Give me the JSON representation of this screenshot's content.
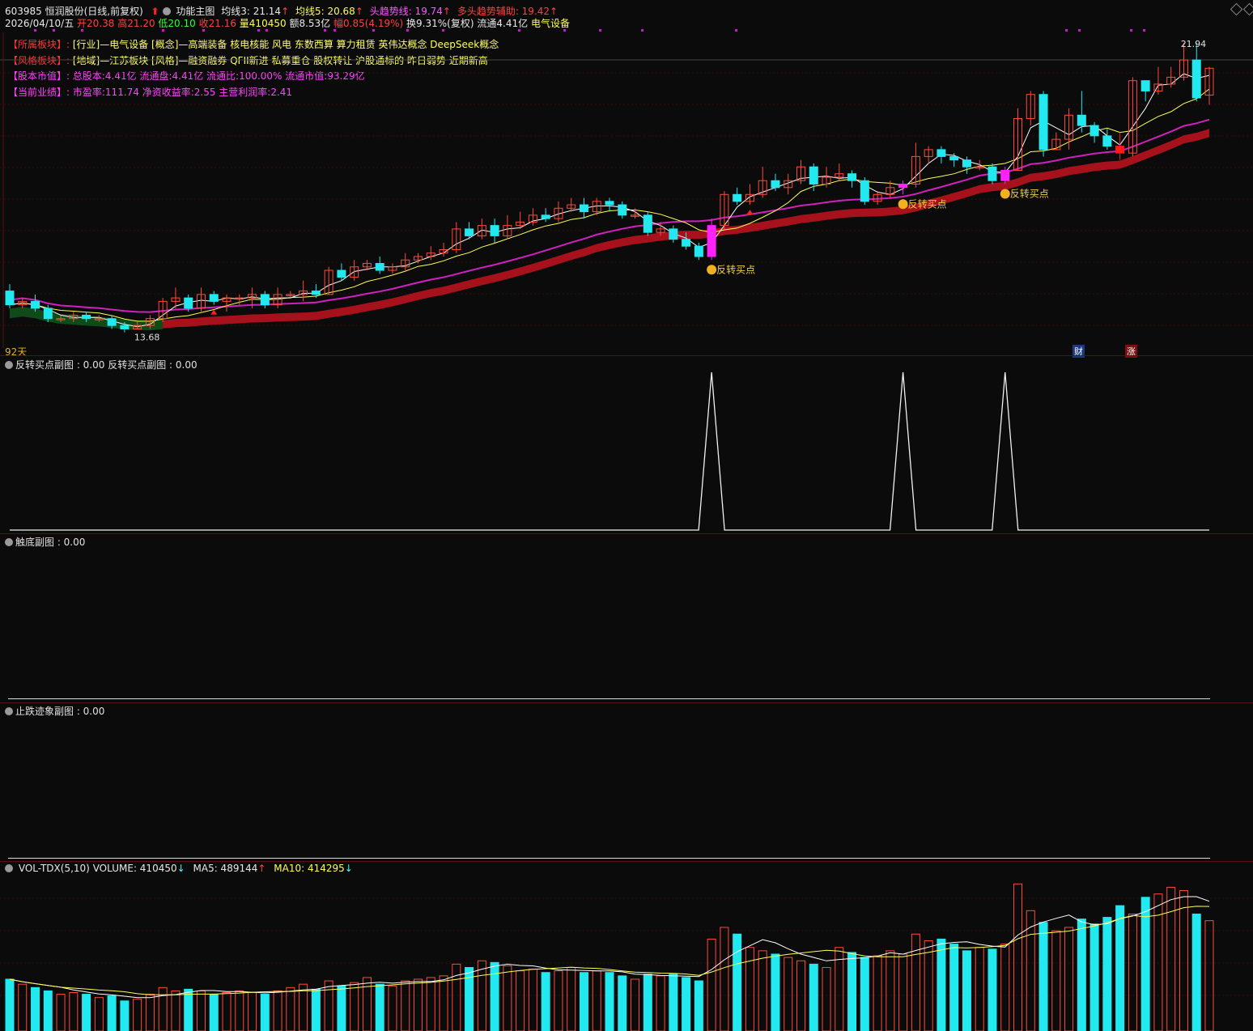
{
  "header": {
    "stock": "603985 恒润股份(日线,前复权)",
    "func_label": "功能主图",
    "ma3": "均线3: 21.14",
    "ma5": "均线5: 20.68",
    "trend_line": "头趋势线: 19.74",
    "trend_aux": "多头趋势辅助: 19.42",
    "date": "2026/04/10/五",
    "open": "开20.38",
    "high": "高21.20",
    "low": "低20.10",
    "close": "收21.16",
    "vol": "量410450",
    "amount": "额8.53亿",
    "change": "幅0.85(4.19%)",
    "turnover": "换9.31%(复权)",
    "float": "流通4.41亿",
    "sector": "电气设备"
  },
  "info": [
    {
      "tag": "【所属板块】:",
      "value": "[行业]—电气设备 [概念]—高端装备 核电核能 风电 东数西算 算力租赁 英伟达概念 DeepSeek概念",
      "color": "#ffff66"
    },
    {
      "tag": "【风格板块】:",
      "value": "[地域]—江苏板块 [风格]—融资融券 QFII新进 私募重仓 股权转让 沪股通标的 昨日弱势 近期新高",
      "color": "#ffff66"
    },
    {
      "tag": "【股本市值】:",
      "value": "总股本:4.41亿 流通盘:4.41亿 流通比:100.00% 流通市值:93.29亿",
      "color": "#ff44ff"
    },
    {
      "tag": "【当前业绩】:",
      "value": "市盈率:111.74 净资收益率:2.55 主营利润率:2.41",
      "color": "#ff44ff"
    }
  ],
  "main_chart": {
    "high_label": "21.94",
    "low_label": "13.68",
    "days_label": "92天",
    "signal_label": "反转买点",
    "badge_cai": "财",
    "badge_zhang": "涨"
  },
  "sub1": {
    "label": "反转买点副图 : 0.00  反转买点副图 : 0.00"
  },
  "sub2": {
    "label": "触底副图 : 0.00"
  },
  "sub3": {
    "label": "止跌迹象副图 : 0.00"
  },
  "vol_panel": {
    "name": "VOL-TDX(5,10)",
    "volume": "VOLUME: 410450",
    "ma5": "MA5: 489144",
    "ma10": "MA10: 414295"
  },
  "chart_data": {
    "type": "candlestick",
    "ohlc": [
      [
        14.7,
        14.3,
        14.9,
        14.2
      ],
      [
        14.3,
        14.4,
        14.5,
        14.2
      ],
      [
        14.4,
        14.2,
        14.6,
        14.1
      ],
      [
        14.2,
        13.9,
        14.3,
        13.8
      ],
      [
        13.9,
        13.9,
        14.0,
        13.8
      ],
      [
        13.9,
        14.0,
        14.1,
        13.8
      ],
      [
        14.0,
        13.9,
        14.1,
        13.8
      ],
      [
        13.9,
        13.9,
        14.0,
        13.8
      ],
      [
        13.9,
        13.7,
        14.0,
        13.6
      ],
      [
        13.7,
        13.6,
        13.8,
        13.5
      ],
      [
        13.6,
        13.7,
        13.8,
        13.6
      ],
      [
        13.7,
        13.9,
        14.0,
        13.6
      ],
      [
        13.9,
        14.4,
        14.5,
        13.8
      ],
      [
        14.4,
        14.5,
        14.8,
        14.2
      ],
      [
        14.5,
        14.2,
        14.6,
        14.1
      ],
      [
        14.2,
        14.6,
        14.8,
        14.1
      ],
      [
        14.6,
        14.4,
        14.7,
        14.3
      ],
      [
        14.4,
        14.5,
        14.6,
        14.1
      ],
      [
        14.5,
        14.5,
        14.6,
        14.3
      ],
      [
        14.5,
        14.6,
        14.8,
        14.2
      ],
      [
        14.6,
        14.3,
        14.7,
        14.2
      ],
      [
        14.3,
        14.6,
        14.8,
        14.2
      ],
      [
        14.6,
        14.6,
        14.7,
        14.5
      ],
      [
        14.6,
        14.7,
        15.0,
        14.4
      ],
      [
        14.7,
        14.6,
        14.9,
        14.5
      ],
      [
        14.6,
        15.3,
        15.4,
        14.6
      ],
      [
        15.3,
        15.1,
        15.5,
        15.0
      ],
      [
        15.1,
        15.4,
        15.6,
        15.0
      ],
      [
        15.4,
        15.5,
        15.6,
        15.3
      ],
      [
        15.5,
        15.3,
        15.7,
        15.2
      ],
      [
        15.3,
        15.4,
        15.5,
        15.2
      ],
      [
        15.4,
        15.6,
        15.8,
        15.3
      ],
      [
        15.6,
        15.7,
        15.8,
        15.5
      ],
      [
        15.7,
        15.8,
        16.0,
        15.6
      ],
      [
        15.8,
        15.9,
        16.1,
        15.7
      ],
      [
        15.9,
        16.5,
        16.7,
        15.8
      ],
      [
        16.5,
        16.3,
        16.7,
        16.2
      ],
      [
        16.3,
        16.6,
        16.8,
        16.2
      ],
      [
        16.6,
        16.3,
        16.8,
        16.1
      ],
      [
        16.3,
        16.6,
        16.9,
        16.2
      ],
      [
        16.6,
        16.7,
        17.0,
        16.5
      ],
      [
        16.7,
        16.9,
        17.1,
        16.6
      ],
      [
        16.9,
        16.8,
        17.1,
        16.7
      ],
      [
        16.8,
        17.1,
        17.3,
        16.7
      ],
      [
        17.1,
        17.2,
        17.4,
        17.0
      ],
      [
        17.2,
        17.0,
        17.4,
        16.8
      ],
      [
        17.0,
        17.3,
        17.4,
        16.9
      ],
      [
        17.3,
        17.2,
        17.4,
        17.0
      ],
      [
        17.2,
        16.9,
        17.3,
        16.8
      ],
      [
        16.9,
        16.9,
        17.1,
        16.8
      ],
      [
        16.9,
        16.4,
        17.0,
        16.3
      ],
      [
        16.4,
        16.5,
        16.7,
        16.3
      ],
      [
        16.5,
        16.2,
        16.6,
        16.1
      ],
      [
        16.2,
        16.0,
        16.4,
        15.9
      ],
      [
        16.0,
        15.7,
        16.1,
        15.6
      ],
      [
        15.7,
        16.6,
        16.8,
        15.6
      ],
      [
        16.6,
        17.5,
        17.6,
        16.5
      ],
      [
        17.5,
        17.3,
        17.7,
        17.2
      ],
      [
        17.3,
        17.5,
        17.8,
        17.2
      ],
      [
        17.5,
        17.9,
        18.3,
        17.4
      ],
      [
        17.9,
        17.7,
        18.1,
        17.6
      ],
      [
        17.7,
        17.9,
        18.1,
        17.5
      ],
      [
        17.9,
        18.3,
        18.5,
        17.8
      ],
      [
        18.3,
        17.8,
        18.4,
        17.6
      ],
      [
        17.8,
        18.0,
        18.3,
        17.7
      ],
      [
        18.0,
        18.1,
        18.4,
        17.9
      ],
      [
        18.1,
        17.9,
        18.2,
        17.7
      ],
      [
        17.9,
        17.3,
        18.0,
        17.2
      ],
      [
        17.3,
        17.5,
        17.6,
        17.2
      ],
      [
        17.5,
        17.7,
        17.9,
        17.4
      ],
      [
        17.7,
        17.8,
        17.9,
        17.5
      ],
      [
        17.8,
        18.6,
        19.0,
        17.7
      ],
      [
        18.6,
        18.8,
        18.9,
        18.4
      ],
      [
        18.8,
        18.6,
        18.9,
        18.4
      ],
      [
        18.6,
        18.5,
        18.7,
        18.3
      ],
      [
        18.5,
        18.3,
        18.6,
        18.1
      ],
      [
        18.3,
        18.3,
        18.5,
        18.2
      ],
      [
        18.3,
        17.9,
        18.4,
        17.8
      ],
      [
        17.9,
        18.2,
        18.3,
        17.8
      ],
      [
        18.2,
        19.7,
        20.0,
        18.2
      ],
      [
        19.7,
        20.4,
        20.5,
        19.5
      ],
      [
        20.4,
        18.8,
        20.5,
        18.6
      ],
      [
        18.8,
        19.1,
        19.3,
        18.8
      ],
      [
        19.1,
        19.8,
        20.0,
        18.8
      ],
      [
        19.8,
        19.5,
        20.5,
        19.3
      ],
      [
        19.5,
        19.2,
        19.6,
        19.0
      ],
      [
        19.2,
        18.9,
        19.4,
        18.8
      ],
      [
        18.9,
        18.7,
        19.3,
        18.5
      ],
      [
        18.7,
        20.8,
        20.9,
        18.6
      ],
      [
        20.8,
        20.5,
        20.8,
        20.2
      ],
      [
        20.5,
        20.7,
        21.2,
        20.4
      ],
      [
        20.7,
        20.9,
        21.2,
        20.6
      ],
      [
        20.9,
        21.4,
        21.9,
        20.8
      ],
      [
        21.4,
        20.3,
        21.9,
        20.2
      ],
      [
        20.38,
        21.16,
        21.2,
        20.1
      ]
    ],
    "volume": [
      31,
      28,
      26,
      24,
      22,
      23,
      22,
      20,
      21,
      18,
      19,
      22,
      26,
      24,
      25,
      24,
      22,
      23,
      24,
      23,
      22,
      24,
      26,
      28,
      25,
      30,
      27,
      29,
      32,
      28,
      27,
      30,
      31,
      32,
      33,
      40,
      38,
      42,
      41,
      39,
      36,
      37,
      35,
      36,
      38,
      35,
      36,
      35,
      33,
      31,
      34,
      33,
      34,
      32,
      30,
      55,
      62,
      58,
      50,
      48,
      46,
      44,
      42,
      40,
      38,
      50,
      47,
      44,
      45,
      48,
      46,
      58,
      54,
      55,
      52,
      48,
      50,
      49,
      52,
      88,
      72,
      65,
      60,
      62,
      67,
      64,
      68,
      75,
      70,
      80,
      82,
      86,
      84,
      70,
      66
    ],
    "signals": [
      55,
      70,
      78
    ]
  }
}
